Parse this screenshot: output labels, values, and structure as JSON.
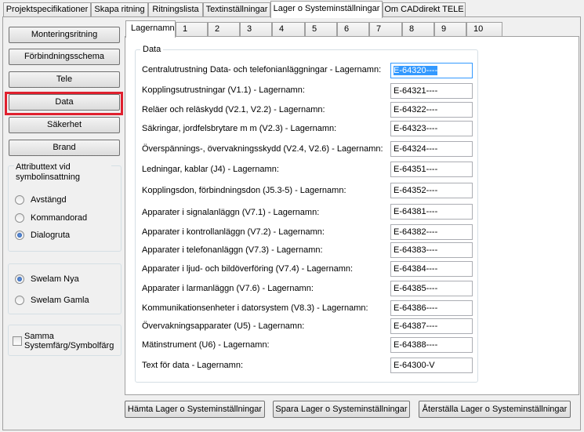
{
  "top_tabs": [
    {
      "label": "Projektspecifikationer"
    },
    {
      "label": "Skapa ritning"
    },
    {
      "label": "Ritningslista"
    },
    {
      "label": "Textinställningar"
    },
    {
      "label": "Lager o Systeminställningar",
      "active": true
    },
    {
      "label": "Om CADdirekt TELE"
    }
  ],
  "left_buttons": [
    {
      "label": "Monteringsritning"
    },
    {
      "label": "Förbindningsschema"
    },
    {
      "label": "Tele"
    },
    {
      "label": "Data",
      "highlighted": true
    },
    {
      "label": "Säkerhet"
    },
    {
      "label": "Brand"
    }
  ],
  "attribute_group": {
    "title": "Attributtext vid symbolinsattning",
    "options": [
      {
        "label": "Avstängd",
        "selected": false
      },
      {
        "label": "Kommandorad",
        "selected": false
      },
      {
        "label": "Dialogruta",
        "selected": true
      }
    ]
  },
  "swelam_group": {
    "options": [
      {
        "label": "Swelam Nya",
        "selected": true
      },
      {
        "label": "Swelam Gamla",
        "selected": false
      }
    ]
  },
  "color_checkbox": {
    "label": "Samma Systemfärg/Symbolfärg",
    "checked": false
  },
  "inner_tabs": [
    {
      "label": "Lagernamn",
      "active": true
    },
    {
      "label": "1"
    },
    {
      "label": "2"
    },
    {
      "label": "3"
    },
    {
      "label": "4"
    },
    {
      "label": "5"
    },
    {
      "label": "6"
    },
    {
      "label": "7"
    },
    {
      "label": "8"
    },
    {
      "label": "9"
    },
    {
      "label": "10"
    }
  ],
  "data_group": {
    "title": "Data",
    "rows": [
      {
        "label": "Centralutrustning Data- och telefonianläggningar - Lagernamn:",
        "value": "E-64320----",
        "focused": true
      },
      {
        "label": "Kopplingsutrustningar (V1.1) - Lagernamn:",
        "value": "E-64321----"
      },
      {
        "label": "Reläer och reläskydd (V2.1, V2.2) - Lagernamn:",
        "value": "E-64322----"
      },
      {
        "label": "Säkringar, jordfelsbrytare m m (V2.3) - Lagernamn:",
        "value": "E-64323----"
      },
      {
        "label": "Överspännings-, övervakningsskydd (V2.4, V2.6) - Lagernamn:",
        "value": "E-64324----"
      },
      {
        "label": "Ledningar, kablar (J4) - Lagernamn:",
        "value": "E-64351----"
      },
      {
        "label": "Kopplingsdon, förbindningsdon (J5.3-5) - Lagernamn:",
        "value": "E-64352----"
      },
      {
        "label": "Apparater i signalanläggn (V7.1) - Lagernamn:",
        "value": "E-64381----"
      },
      {
        "label": "Apparater i kontrollanläggn (V7.2) - Lagernamn:",
        "value": "E-64382----"
      },
      {
        "label": "Apparater i telefonanläggn (V7.3) - Lagernamn:",
        "value": "E-64383----"
      },
      {
        "label": "Apparater i ljud- och bildöverföring (V7.4) - Lagernamn:",
        "value": "E-64384----"
      },
      {
        "label": "Apparater i larmanläggn (V7.6) - Lagernamn:",
        "value": "E-64385----"
      },
      {
        "label": "Kommunikationsenheter i datorsystem (V8.3) - Lagernamn:",
        "value": "E-64386----"
      },
      {
        "label": "Övervakningsapparater (U5) - Lagernamn:",
        "value": "E-64387----"
      },
      {
        "label": "Mätinstrument (U6) - Lagernamn:",
        "value": "E-64388----"
      },
      {
        "label": "Text för data - Lagernamn:",
        "value": "E-64300-V"
      }
    ]
  },
  "bottom_buttons": {
    "fetch": "Hämta Lager o Systeminställningar",
    "save": "Spara Lager o Systeminställningar",
    "restore": "Återställa Lager o Systeminställningar"
  },
  "colors": {
    "highlight_frame": "#e0202e",
    "focus_border": "#3399ff"
  }
}
